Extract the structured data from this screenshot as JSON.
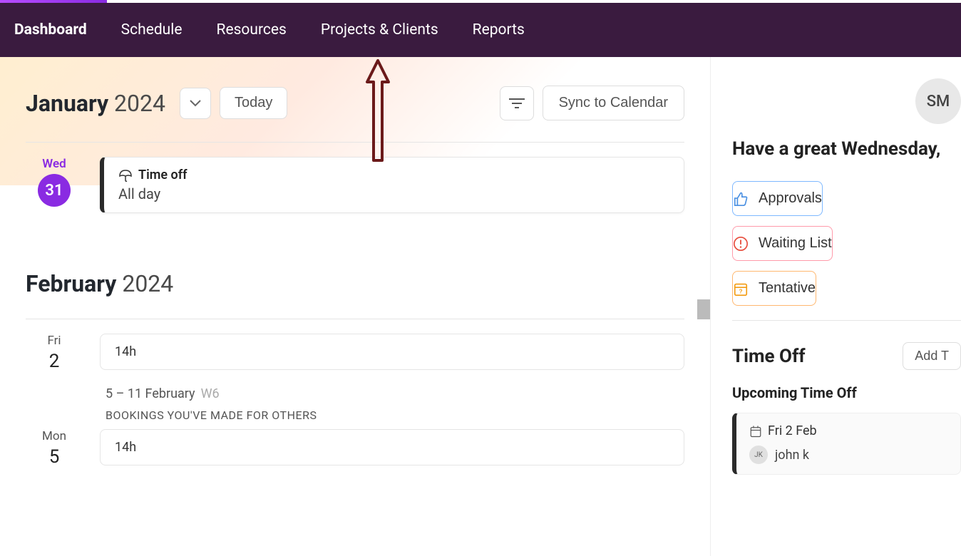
{
  "nav": {
    "items": [
      {
        "label": "Dashboard",
        "active": true
      },
      {
        "label": "Schedule",
        "active": false
      },
      {
        "label": "Resources",
        "active": false
      },
      {
        "label": "Projects & Clients",
        "active": false
      },
      {
        "label": "Reports",
        "active": false
      }
    ]
  },
  "calendar": {
    "month1_name": "January",
    "month1_year": "2024",
    "today_label": "Today",
    "sync_label": "Sync to Calendar",
    "day1": {
      "weekday": "Wed",
      "num": "31",
      "is_today": true,
      "event_title": "Time off",
      "event_sub": "All day"
    },
    "month2_name": "February",
    "month2_year": "2024",
    "day2": {
      "weekday": "Fri",
      "num": "2",
      "hours": "14h"
    },
    "week_range": "5 – 11 February",
    "week_num": "W6",
    "bookings_label": "BOOKINGS YOU'VE MADE FOR OTHERS",
    "day3": {
      "weekday": "Mon",
      "num": "5",
      "hours": "14h"
    }
  },
  "sidebar": {
    "avatar_initials": "SM",
    "greeting": "Have a great Wednesday,",
    "approvals_label": "Approvals",
    "waiting_label": "Waiting List",
    "tentative_label": "Tentative",
    "timeoff_title": "Time Off",
    "add_label": "Add T",
    "upcoming_title": "Upcoming Time Off",
    "upcoming_date": "Fri 2 Feb",
    "upcoming_person_initials": "JK",
    "upcoming_person_name": "john k"
  }
}
